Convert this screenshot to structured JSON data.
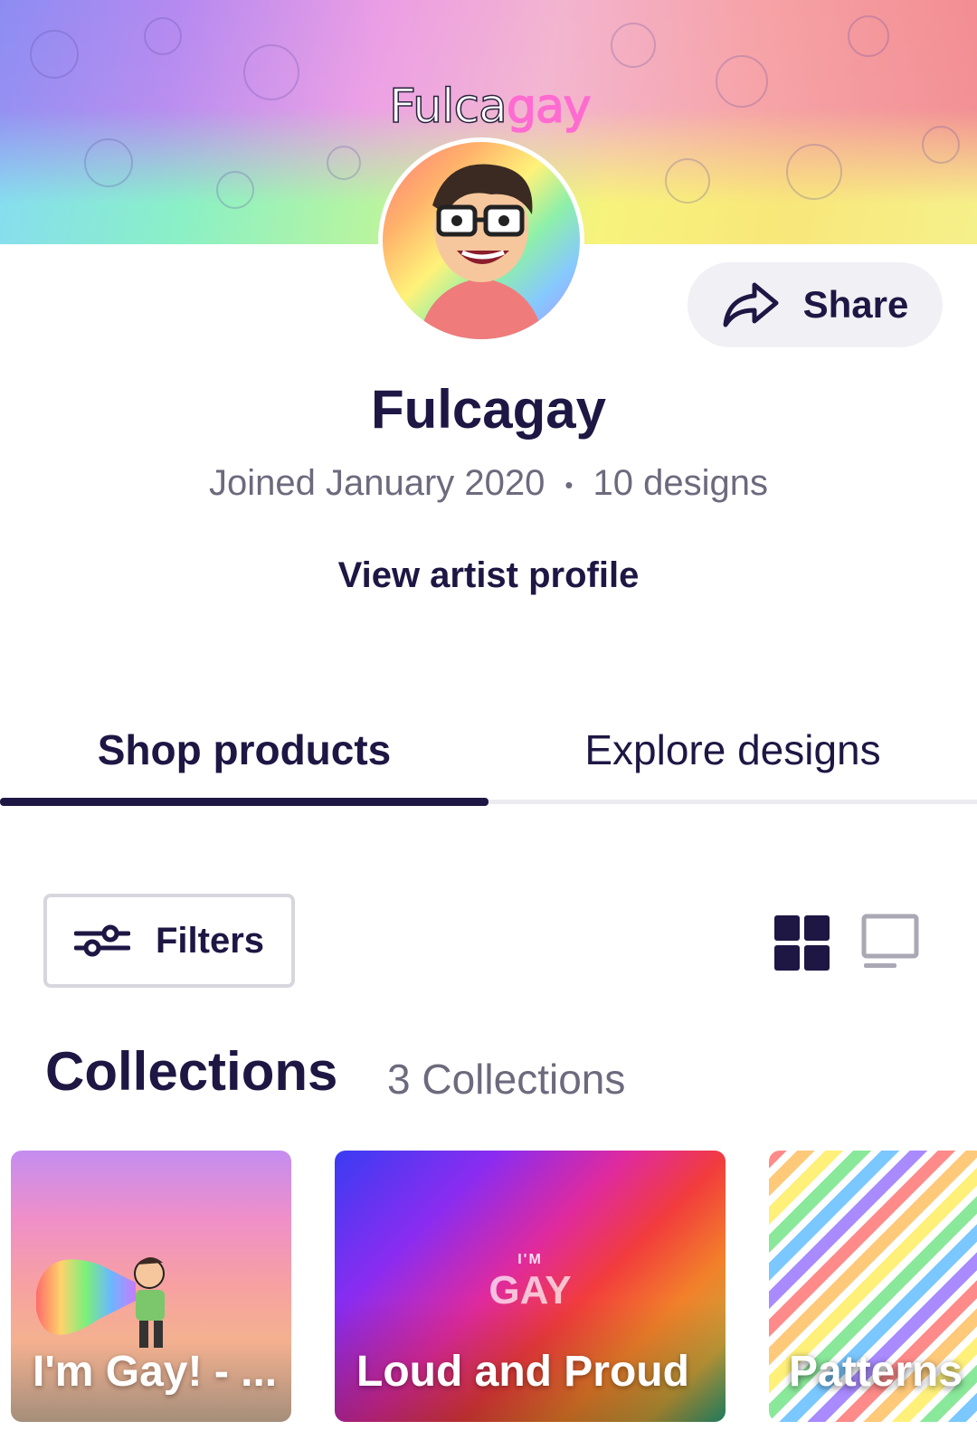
{
  "banner": {
    "logo_text_main": "Fulca",
    "logo_text_accent": "gay"
  },
  "share": {
    "label": "Share"
  },
  "profile": {
    "name": "Fulcagay",
    "joined": "Joined January 2020",
    "separator": "•",
    "designs": "10 designs",
    "view_profile_link": "View artist profile"
  },
  "tabs": [
    {
      "label": "Shop products",
      "active": true
    },
    {
      "label": "Explore designs",
      "active": false
    }
  ],
  "toolbar": {
    "filters_label": "Filters",
    "view_modes": [
      "grid-view-icon",
      "list-view-icon"
    ],
    "active_view": "grid"
  },
  "collections": {
    "title": "Collections",
    "count_label": "3 Collections",
    "items": [
      {
        "title": "I'm Gay! - ..."
      },
      {
        "title": "Loud and Proud",
        "art_small": "I'M",
        "art_big": "GAY"
      },
      {
        "title": "Patterns"
      }
    ]
  },
  "colors": {
    "primary": "#1e1744",
    "muted": "#6c6a7d",
    "chip_bg": "#f1f0f5",
    "border": "#d7d6dd"
  }
}
